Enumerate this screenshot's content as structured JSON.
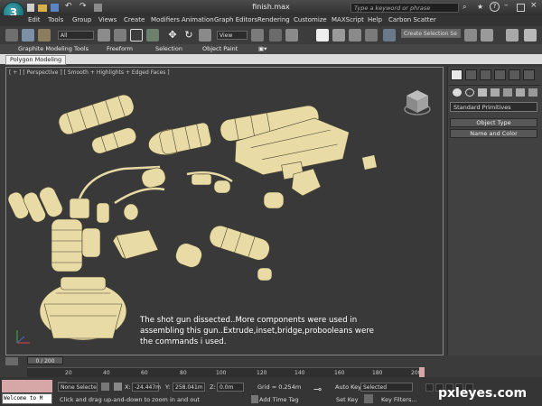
{
  "app": {
    "title": "finish.max",
    "logo_glyph": "3",
    "search_placeholder": "Type a keyword or phrase"
  },
  "menu": [
    "Edit",
    "Tools",
    "Group",
    "Views",
    "Create",
    "Modifiers",
    "Animation",
    "Graph Editors",
    "Rendering",
    "Customize",
    "MAXScript",
    "Help",
    "Carbon Scatter"
  ],
  "toolbar": {
    "selection_filter": "All",
    "ref_coord": "View",
    "named_selection": "Create Selection Se"
  },
  "ribbon": {
    "tabs": [
      "Graphite Modeling Tools",
      "Freeform",
      "Selection",
      "Object Paint"
    ],
    "sub_tab": "Polygon Modeling"
  },
  "viewport": {
    "label": "[ + ] [ Perspective ] [ Smooth + Highlights + Edged Faces ]",
    "caption": [
      "The shot gun dissected..More components were used in",
      "assembling this gun..Extrude,inset,bridge,probooleans were",
      "the commands i used."
    ]
  },
  "command_panel": {
    "primitive_dropdown": "Standard Primitives",
    "rollouts": [
      "Object Type",
      "Name and Color"
    ]
  },
  "timeline": {
    "slider": "0 / 200",
    "ticks": [
      "20",
      "40",
      "60",
      "80",
      "100",
      "120",
      "140",
      "160",
      "180",
      "200"
    ]
  },
  "status": {
    "selection": "None Selecte",
    "x_label": "X:",
    "x_value": "-24.447m",
    "y_label": "Y:",
    "y_value": "258.041m",
    "z_label": "Z:",
    "z_value": "0.0m",
    "grid": "Grid = 0.254m",
    "auto_key": "Auto Key",
    "set_key": "Set Key",
    "key_mode": "Selected",
    "key_filters": "Key Filters...",
    "add_time_tag": "Add Time Tag",
    "prompt": "Click and drag up-and-down to zoom in and out",
    "welcome": "Welcome to M"
  },
  "watermark": "pxleyes.com",
  "colors": {
    "model": "#e8dba5",
    "model_edge": "#4a4530",
    "viewport_bg": "#393939",
    "status_pink": "#d7a6a6"
  }
}
